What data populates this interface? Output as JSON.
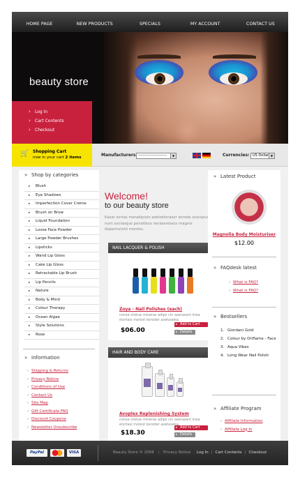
{
  "nav": [
    "HOME PAGE",
    "NEW PRODUCTS",
    "SPECIALS",
    "MY ACCOUNT",
    "CONTACT US"
  ],
  "hero": {
    "brand": "beauty store",
    "quick_links": [
      "Log In",
      "Cart Contents",
      "Checkout"
    ]
  },
  "cart": {
    "title": "Shopping Cart",
    "status_prefix": "now in your cart ",
    "count": "2 items"
  },
  "filters": {
    "manufacturers_label": "Manufacturers:",
    "manufacturers_value": "-----------------------",
    "currencies_label": "Currencies:",
    "currencies_value": "US Dollar"
  },
  "categories": {
    "title": "Shop by categories",
    "items": [
      "Blush",
      "Eye Shadows",
      "Imperfection Cover Creme",
      "Brush on Brow",
      "Liquid Foundation",
      "Loose Face Powder",
      "Large Powder Brushes",
      "Lipsticks",
      "Wand Lip Gloss",
      "Cake Lip Gloss",
      "Retractable Lip Brush",
      "Lip Pencils",
      "Nature",
      "Body & Mind",
      "Colour Therapy",
      "Ocean Algae",
      "Style Solutions",
      "Rose"
    ]
  },
  "information": {
    "title": "Information",
    "items": [
      "Shipping & Returns",
      "Privacy Notice",
      "Conditions of Use",
      "Contact Us",
      "Site Map",
      "Gift Certificate FAQ",
      "Discount Coupons",
      "Newsletter Unsubscribe"
    ]
  },
  "welcome": {
    "line1": "Welcome!",
    "line2": "to our beauty store",
    "text": "Kasar sertas meradipisin adelokteraser kerode suscipius num sociseque penatibus neraseretace magnis doparturient montes."
  },
  "products": [
    {
      "section": "NAIL LACQUER & POLISH",
      "name": "Zoya - Nail Polishes (each)",
      "desc": "conse ctetue miseras adips cin asenaseri krea elortasi molest keroder asetaseka.",
      "price": "$06.00",
      "add": "Add to Cart",
      "details": "Details"
    },
    {
      "section": "HAIR AND BODY CARE",
      "name": "Avoplex Replenishing System",
      "desc": "conse ctetue miseras adips cin asenaseri krea elortasi molest keroder asetaseka.",
      "price": "$18.30",
      "add": "Add to Cart",
      "details": "Details"
    }
  ],
  "latest": {
    "title": "Latest Product",
    "name": "Magnolia Body Moisturiser",
    "price": "$12.00"
  },
  "faq": {
    "title": "FAQdesk latest",
    "items": [
      "What is FAQ?",
      "What is FAQ?"
    ]
  },
  "bestsellers": {
    "title": "Bestsellers",
    "items": [
      {
        "n": "1.",
        "label": "Giordani Gold"
      },
      {
        "n": "2.",
        "label": "Colour by Oriflame - Face"
      },
      {
        "n": "3.",
        "label": "Aqua Vibes"
      },
      {
        "n": "4.",
        "label": "Long Wear Nail Polish"
      }
    ]
  },
  "affiliate": {
    "title": "Affiliate Program",
    "items": [
      "Affiliate Information",
      "Affiliate Log In"
    ]
  },
  "footer": {
    "payments": [
      "PayPal",
      "MasterCard",
      "VISA"
    ],
    "copyright": "Beauty Store © 2008",
    "privacy": "Privacy Notice",
    "links": [
      "Log In",
      "Cart Contents",
      "Checkout"
    ]
  },
  "colors": {
    "accent": "#c8213e",
    "cart_yellow": "#f7e300",
    "dark": "#2a2a2a"
  }
}
